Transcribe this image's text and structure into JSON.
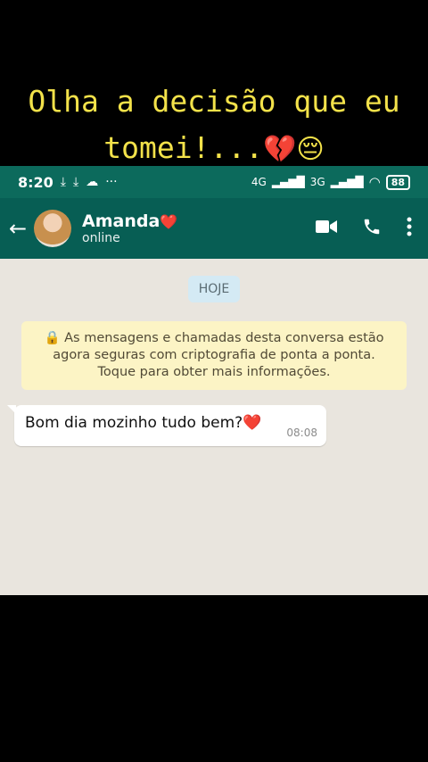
{
  "overlay": {
    "line1": "Olha a decisão que eu",
    "line2": "tomei!...",
    "emojis": "💔😔"
  },
  "statusbar": {
    "time": "8:20",
    "net1": "4G",
    "net2": "3G",
    "battery": "88"
  },
  "header": {
    "contact_name": "Amanda",
    "name_emoji": "❤️",
    "status": "online"
  },
  "chat": {
    "date_pill": "HOJE",
    "encryption_notice": "As mensagens e chamadas desta conversa estão agora seguras com criptografia de ponta a ponta. Toque para obter mais informações.",
    "messages": [
      {
        "text": "Bom dia mozinho tudo bem?",
        "emoji": "❤️",
        "time": "08:08"
      }
    ]
  },
  "colors": {
    "appbar": "#075e54",
    "statusbar": "#0c6a5c",
    "chat_bg": "#e9e5de",
    "notice_bg": "#fcf4c5",
    "caption_text": "#f3e24a"
  }
}
